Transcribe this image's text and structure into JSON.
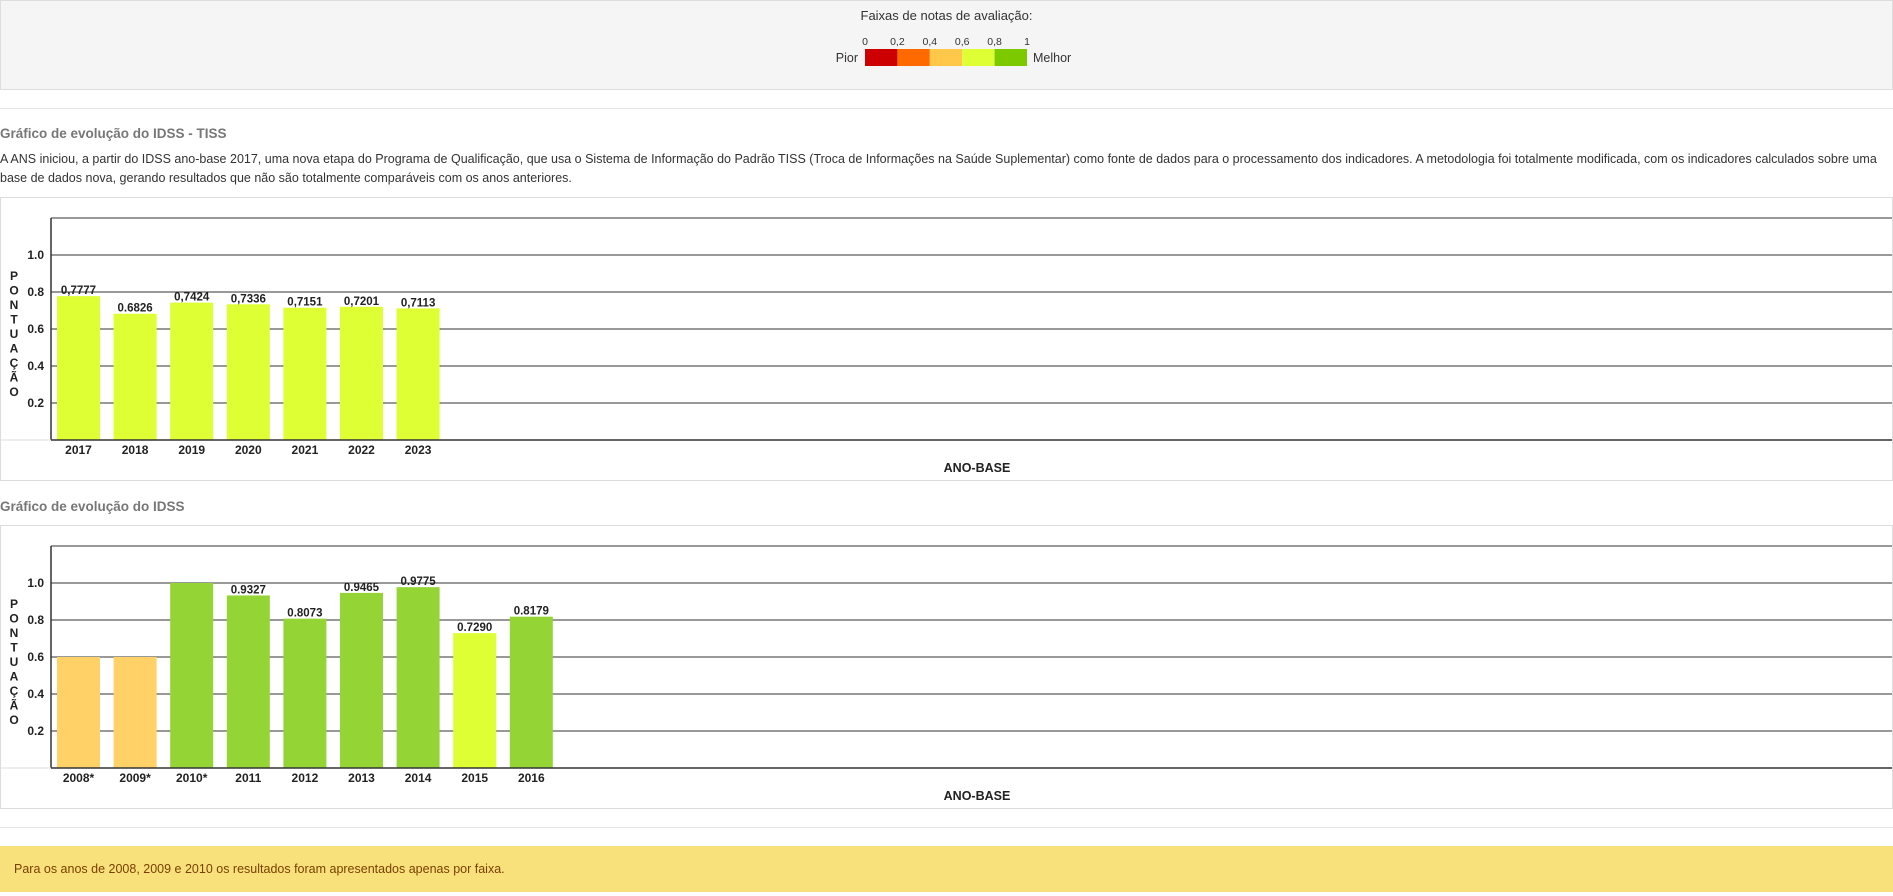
{
  "legend": {
    "title": "Faixas de notas de avaliação:",
    "worst_label": "Pior",
    "best_label": "Melhor",
    "ticks": [
      "0",
      "0,2",
      "0,4",
      "0,6",
      "0,8",
      "1"
    ],
    "band_colors": [
      "#cc0000",
      "#ff6a00",
      "#ffc84a",
      "#ddff33",
      "#7cc900"
    ]
  },
  "tiss_section": {
    "title": "Gráfico de evolução do IDSS - TISS",
    "description": "A ANS iniciou, a partir do IDSS ano-base 2017, uma nova etapa do Programa de Qualificação, que usa o Sistema de Informação do Padrão TISS (Troca de Informações na Saúde Suplementar) como fonte de dados para o processamento dos indicadores. A metodologia foi totalmente modificada, com os indicadores calculados sobre uma base de dados nova, gerando resultados que não são totalmente comparáveis com os anos anteriores."
  },
  "idss_section": {
    "title": "Gráfico de evolução do IDSS"
  },
  "note": "Para os anos de 2008, 2009 e 2010 os resultados foram apresentados apenas por faixa.",
  "chart_data": [
    {
      "type": "bar",
      "ylabel": "PONTUAÇÃO",
      "xlabel": "ANO-BASE",
      "ylim": [
        0,
        1.2
      ],
      "yticks": [
        "0.2",
        "0.4",
        "0.6",
        "0.8",
        "1.0"
      ],
      "categories": [
        "2017",
        "2018",
        "2019",
        "2020",
        "2021",
        "2022",
        "2023"
      ],
      "values": [
        0.7777,
        0.6826,
        0.7424,
        0.7336,
        0.7151,
        0.7201,
        0.7113
      ],
      "value_labels": [
        "0,7777",
        "0.6826",
        "0,7424",
        "0,7336",
        "0,7151",
        "0,7201",
        "0,7113"
      ],
      "colors": [
        "#ddff33",
        "#ddff33",
        "#ddff33",
        "#ddff33",
        "#ddff33",
        "#ddff33",
        "#ddff33"
      ],
      "grid": true
    },
    {
      "type": "bar",
      "ylabel": "PONTUAÇÃO",
      "xlabel": "ANO-BASE",
      "ylim": [
        0,
        1.2
      ],
      "yticks": [
        "0.2",
        "0.4",
        "0.6",
        "0.8",
        "1.0"
      ],
      "categories": [
        "2008*",
        "2009*",
        "2010*",
        "2011",
        "2012",
        "2013",
        "2014",
        "2015",
        "2016"
      ],
      "values": [
        0.6,
        0.6,
        1.0,
        0.9327,
        0.8073,
        0.9465,
        0.9775,
        0.729,
        0.8179
      ],
      "value_labels": [
        "",
        "",
        "",
        "0.9327",
        "0.8073",
        "0.9465",
        "0.9775",
        "0.7290",
        "0.8179"
      ],
      "colors": [
        "#ffd166",
        "#ffd166",
        "#94d435",
        "#94d435",
        "#94d435",
        "#94d435",
        "#94d435",
        "#ddff33",
        "#94d435"
      ],
      "grid": true
    }
  ]
}
